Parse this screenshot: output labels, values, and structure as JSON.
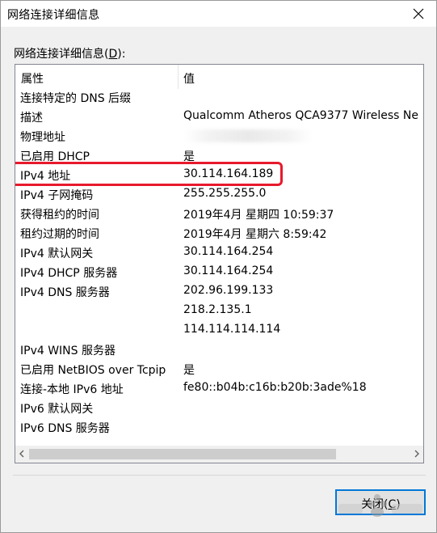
{
  "window": {
    "title": "网络连接详细信息"
  },
  "group": {
    "label_prefix": "网络连接详细信息(",
    "mnemonic": "D",
    "label_suffix": "):"
  },
  "table": {
    "headers": [
      "属性",
      "值"
    ],
    "rows": [
      {
        "key": "连接特定的 DNS 后缀",
        "value": ""
      },
      {
        "key": "描述",
        "value": "Qualcomm Atheros QCA9377 Wireless Ne"
      },
      {
        "key": "物理地址",
        "value": "",
        "obscured": true
      },
      {
        "key": "已启用 DHCP",
        "value": "是"
      },
      {
        "key": "IPv4 地址",
        "value": "30.114.164.189",
        "highlighted": true
      },
      {
        "key": "IPv4 子网掩码",
        "value": "255.255.255.0"
      },
      {
        "key": "获得租约的时间",
        "value": "2019年4月 星期四 10:59:37"
      },
      {
        "key": "租约过期的时间",
        "value": "2019年4月 星期六 8:59:42"
      },
      {
        "key": "IPv4 默认网关",
        "value": "30.114.164.254"
      },
      {
        "key": "IPv4 DHCP 服务器",
        "value": "30.114.164.254"
      },
      {
        "key": "IPv4 DNS 服务器",
        "value": "202.96.199.133"
      },
      {
        "key": "",
        "value": "218.2.135.1"
      },
      {
        "key": "",
        "value": "114.114.114.114"
      },
      {
        "key": "IPv4 WINS 服务器",
        "value": ""
      },
      {
        "key": "已启用 NetBIOS over Tcpip",
        "value": "是"
      },
      {
        "key": "连接-本地 IPv6 地址",
        "value": "fe80::b04b:c16b:b20b:3ade%18"
      },
      {
        "key": "IPv6 默认网关",
        "value": ""
      },
      {
        "key": "IPv6 DNS 服务器",
        "value": ""
      }
    ]
  },
  "close_button": {
    "label_prefix": "关闭(",
    "mnemonic": "C",
    "label_suffix": ")"
  },
  "colors": {
    "highlight": "#e8192c",
    "button_focus": "#0078d7"
  },
  "icons": {
    "close": "close-icon",
    "scroll_left": "chevron-left-icon",
    "scroll_right": "chevron-right-icon"
  }
}
